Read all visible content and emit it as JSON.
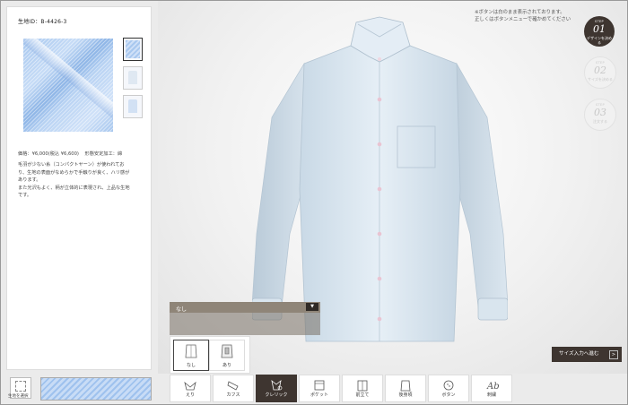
{
  "fabric": {
    "id_label": "生地ID：B-4426-3",
    "price": "価格：¥6,000(税込 ¥6,600)",
    "treatment": "形態安定加工：綿",
    "description_lines": [
      "毛羽が少ない糸（コンパクトヤーン）が使われてお",
      "り、生地の表面がなめらかで手触りが良く、ハリ感が",
      "あります。",
      "また光沢もよく、柄が立体的に表現され、上品な生地",
      "です。"
    ]
  },
  "fabric_select_label": "生地を選択",
  "notice_lines": [
    "※ボタンは白のまま表示されております。",
    "正しくはボタンメニューで確かめてください"
  ],
  "steps": [
    {
      "label": "STEP",
      "num": "01",
      "text": "デザインを決める",
      "state": "active"
    },
    {
      "label": "STEP",
      "num": "02",
      "text": "サイズを決める",
      "state": "inactive"
    },
    {
      "label": "STEP",
      "num": "03",
      "text": "注文する",
      "state": "inactive"
    }
  ],
  "option_panel": {
    "selected": "なし",
    "choices": [
      {
        "label": "なし",
        "icon": "cuff-plain-icon",
        "selected": true
      },
      {
        "label": "あり",
        "icon": "cuff-clip-icon",
        "selected": false
      }
    ]
  },
  "size_button": {
    "label": "サイズ入力へ進む",
    "arrow": ">"
  },
  "tabs": [
    {
      "label": "えり",
      "icon": "collar-icon",
      "active": false
    },
    {
      "label": "カフス",
      "icon": "cuffs-icon",
      "active": false
    },
    {
      "label": "クレリック",
      "icon": "cleric-icon",
      "active": true
    },
    {
      "label": "ポケット",
      "icon": "pocket-icon",
      "active": false
    },
    {
      "label": "前立て",
      "icon": "placket-icon",
      "active": false
    },
    {
      "label": "後身頃",
      "icon": "back-body-icon",
      "active": false
    },
    {
      "label": "ボタン",
      "icon": "button-icon",
      "active": false
    },
    {
      "label": "刺繍",
      "icon": "embroidery-icon",
      "active": false
    }
  ],
  "colors": {
    "accent_dark": "#3e3530",
    "fabric_blue": "#a8c8ef",
    "panel_gray": "#8f8578"
  }
}
